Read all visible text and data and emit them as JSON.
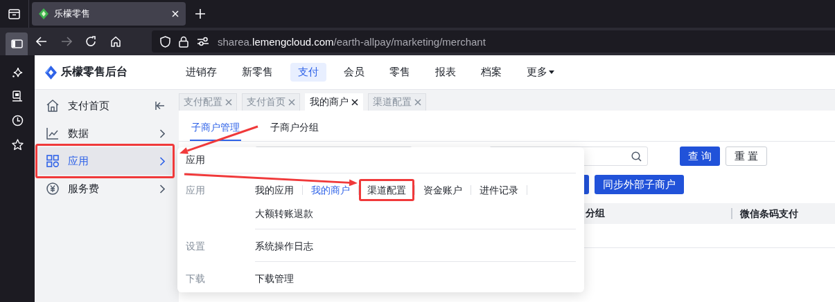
{
  "browser": {
    "tab_title": "乐檬零售",
    "url": {
      "prefix": "sharea.",
      "domain": "lemengcloud.com",
      "path": "/earth-allpay/marketing/merchant"
    },
    "back_disabled": false,
    "forward_disabled": true
  },
  "app": {
    "logo_text": "乐檬零售后台",
    "nav": [
      {
        "label": "进销存",
        "selected": false
      },
      {
        "label": "新零售",
        "selected": false
      },
      {
        "label": "支付",
        "selected": true
      },
      {
        "label": "会员",
        "selected": false
      },
      {
        "label": "零售",
        "selected": false
      },
      {
        "label": "报表",
        "selected": false
      },
      {
        "label": "档案",
        "selected": false
      },
      {
        "label": "更多",
        "selected": false,
        "dropdown": true
      }
    ]
  },
  "side_menu": [
    {
      "label": "支付首页",
      "kind": "home",
      "collapsible": true,
      "selected": false,
      "annotated": false
    },
    {
      "label": "数据",
      "kind": "chart",
      "collapsible": false,
      "selected": false,
      "annotated": false
    },
    {
      "label": "应用",
      "kind": "apps",
      "collapsible": false,
      "selected": true,
      "annotated": true
    },
    {
      "label": "服务费",
      "kind": "fee",
      "collapsible": false,
      "selected": false,
      "annotated": false
    }
  ],
  "page_tabs": [
    {
      "label": "支付配置",
      "selected": false
    },
    {
      "label": "支付首页",
      "selected": false
    },
    {
      "label": "我的商户",
      "selected": true
    },
    {
      "label": "渠道配置",
      "selected": false
    }
  ],
  "sub_tabs": [
    {
      "label": "子商户管理",
      "selected": true
    },
    {
      "label": "子商户分组",
      "selected": false
    }
  ],
  "search_buttons": [
    {
      "label": "查 询",
      "kind": "primary"
    },
    {
      "label": "重 置",
      "kind": "plain"
    }
  ],
  "action_buttons": [
    {
      "label": "同步外部子商户"
    }
  ],
  "table": {
    "columns": [
      "分组",
      "微信条码支付"
    ]
  },
  "popup": {
    "title": "应用",
    "groups": [
      {
        "label": "应用",
        "items": [
          {
            "label": "我的应用",
            "selected": false,
            "annotated": false
          },
          {
            "label": "我的商户",
            "selected": true,
            "annotated": false
          },
          {
            "label": "渠道配置",
            "selected": false,
            "annotated": true
          },
          {
            "label": "资金账户",
            "selected": false,
            "annotated": false
          },
          {
            "label": "进件记录",
            "selected": false,
            "annotated": false
          },
          {
            "label": "大额转账退款",
            "selected": false,
            "annotated": false
          }
        ]
      },
      {
        "label": "设置",
        "items": [
          {
            "label": "系统操作日志",
            "selected": false,
            "annotated": false
          }
        ]
      },
      {
        "label": "下载",
        "items": [
          {
            "label": "下载管理",
            "selected": false,
            "annotated": false
          }
        ]
      }
    ]
  }
}
